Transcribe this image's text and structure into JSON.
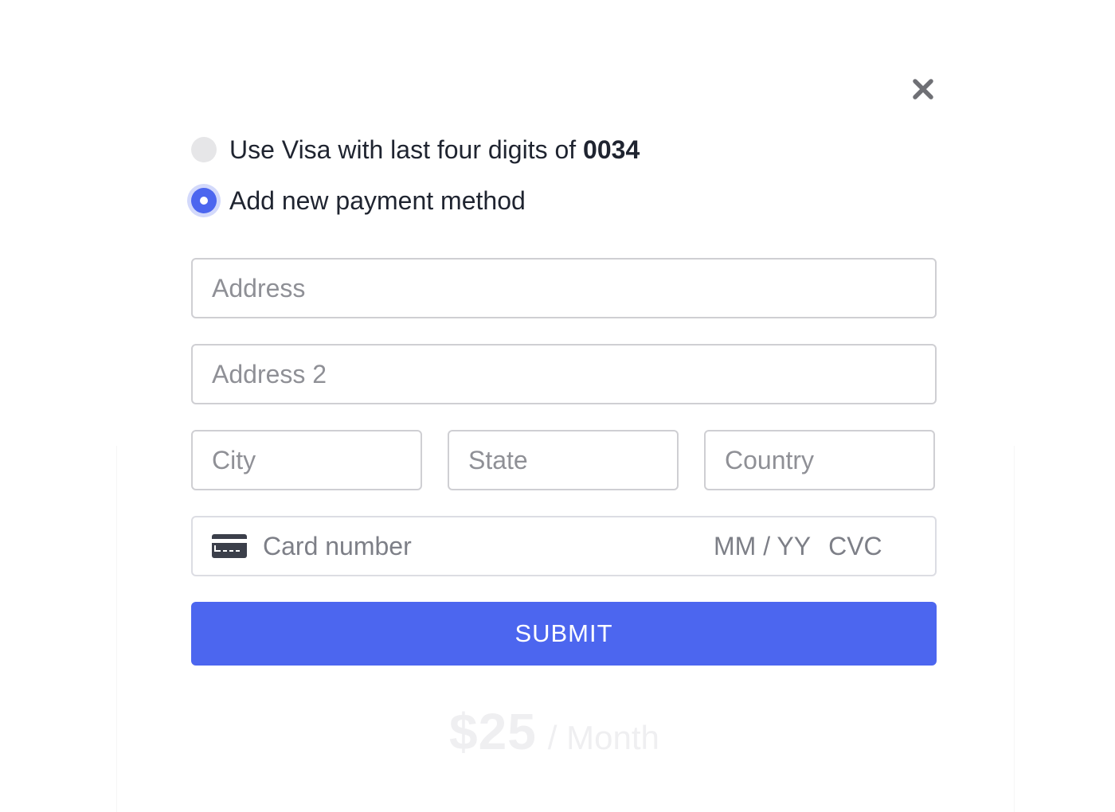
{
  "background_card": {
    "price_amount": "$25",
    "price_period": "/ Month"
  },
  "modal": {
    "close_icon": "close-icon",
    "payment_options": [
      {
        "label_prefix": "Use Visa with last four digits of ",
        "last_four": "0034",
        "selected": false
      },
      {
        "label": "Add new payment method",
        "selected": true
      }
    ],
    "fields": {
      "address_placeholder": "Address",
      "address2_placeholder": "Address 2",
      "city_placeholder": "City",
      "state_placeholder": "State",
      "country_placeholder": "Country"
    },
    "card": {
      "icon": "credit-card-icon",
      "number_placeholder": "Card number",
      "expiry_placeholder": "MM / YY",
      "cvc_placeholder": "CVC"
    },
    "submit_label": "SUBMIT"
  },
  "colors": {
    "accent": "#4c66ef",
    "radio_off": "#e6e6e8",
    "placeholder": "#8f9096"
  }
}
